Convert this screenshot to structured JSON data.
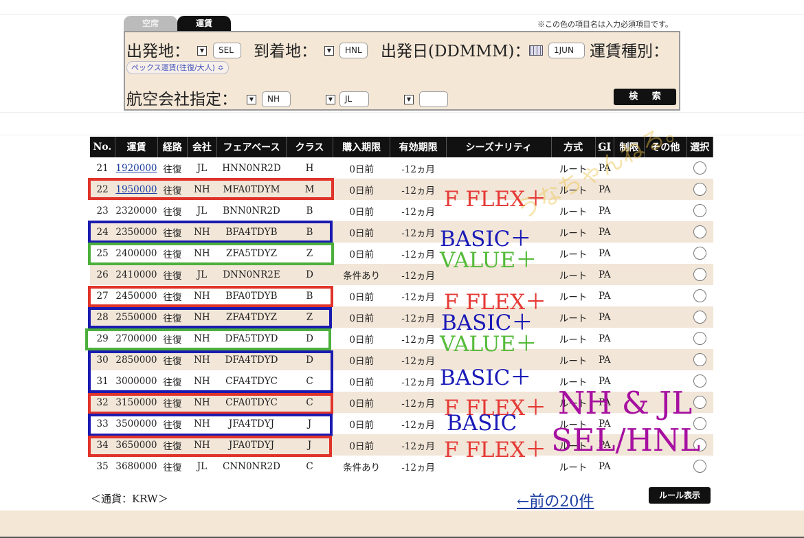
{
  "tabs": [
    {
      "label": "空席",
      "active": false
    },
    {
      "label": "運賃",
      "active": true
    }
  ],
  "required_note": "※この色の項目名は入力必須項目です。",
  "search": {
    "origin_label": "出発地：",
    "origin_value": "SEL",
    "dest_label": "到着地：",
    "dest_value": "HNL",
    "date_label": "出発日(DDMMM)：",
    "date_value": "1JUN",
    "fare_type_label": "運賃種別：",
    "fare_type_value": "ペックス運賃(往復/大人)",
    "airline_label": "航空会社指定：",
    "airline1": "NH",
    "airline2": "JL",
    "airline3": "",
    "search_button": "検 索"
  },
  "table": {
    "headers": [
      "No.",
      "運賃",
      "経路",
      "会社",
      "フェアベース",
      "クラス",
      "購入期限",
      "有効期限",
      "シーズナリティ",
      "方式",
      "GI",
      "制限",
      "その他",
      "選択"
    ],
    "rows": [
      {
        "no": "21",
        "fare": "1920000",
        "linked": true,
        "route": "往復",
        "carrier": "JL",
        "fare_basis": "HNN0NR2D",
        "class": "H",
        "purchase": "0日前",
        "validity": "-12ヵ月",
        "method": "ルート",
        "gi": "PA"
      },
      {
        "no": "22",
        "fare": "1950000",
        "linked": true,
        "route": "往復",
        "carrier": "NH",
        "fare_basis": "MFA0TDYM",
        "class": "M",
        "purchase": "0日前",
        "validity": "-12ヵ月",
        "method": "ルート",
        "gi": "PA"
      },
      {
        "no": "23",
        "fare": "2320000",
        "linked": false,
        "route": "往復",
        "carrier": "JL",
        "fare_basis": "BNN0NR2D",
        "class": "B",
        "purchase": "0日前",
        "validity": "-12ヵ月",
        "method": "ルート",
        "gi": "PA"
      },
      {
        "no": "24",
        "fare": "2350000",
        "linked": false,
        "route": "往復",
        "carrier": "NH",
        "fare_basis": "BFA4TDYB",
        "class": "B",
        "purchase": "0日前",
        "validity": "-12ヵ月",
        "method": "ルート",
        "gi": "PA"
      },
      {
        "no": "25",
        "fare": "2400000",
        "linked": false,
        "route": "往復",
        "carrier": "NH",
        "fare_basis": "ZFA5TDYZ",
        "class": "Z",
        "purchase": "0日前",
        "validity": "-12ヵ月",
        "method": "ルート",
        "gi": "PA"
      },
      {
        "no": "26",
        "fare": "2410000",
        "linked": false,
        "route": "往復",
        "carrier": "JL",
        "fare_basis": "DNN0NR2E",
        "class": "D",
        "purchase": "条件あり",
        "validity": "-12ヵ月",
        "method": "ルート",
        "gi": "PA"
      },
      {
        "no": "27",
        "fare": "2450000",
        "linked": false,
        "route": "往復",
        "carrier": "NH",
        "fare_basis": "BFA0TDYB",
        "class": "B",
        "purchase": "0日前",
        "validity": "-12ヵ月",
        "method": "ルート",
        "gi": "PA"
      },
      {
        "no": "28",
        "fare": "2550000",
        "linked": false,
        "route": "往復",
        "carrier": "NH",
        "fare_basis": "ZFA4TDYZ",
        "class": "Z",
        "purchase": "0日前",
        "validity": "-12ヵ月",
        "method": "ルート",
        "gi": "PA"
      },
      {
        "no": "29",
        "fare": "2700000",
        "linked": false,
        "route": "往復",
        "carrier": "NH",
        "fare_basis": "DFA5TDYD",
        "class": "D",
        "purchase": "0日前",
        "validity": "-12ヵ月",
        "method": "ルート",
        "gi": "PA"
      },
      {
        "no": "30",
        "fare": "2850000",
        "linked": false,
        "route": "往復",
        "carrier": "NH",
        "fare_basis": "DFA4TDYD",
        "class": "D",
        "purchase": "0日前",
        "validity": "-12ヵ月",
        "method": "ルート",
        "gi": "PA"
      },
      {
        "no": "31",
        "fare": "3000000",
        "linked": false,
        "route": "往復",
        "carrier": "NH",
        "fare_basis": "CFA4TDYC",
        "class": "C",
        "purchase": "0日前",
        "validity": "-12ヵ月",
        "method": "ルート",
        "gi": "PA"
      },
      {
        "no": "32",
        "fare": "3150000",
        "linked": false,
        "route": "往復",
        "carrier": "NH",
        "fare_basis": "CFA0TDYC",
        "class": "C",
        "purchase": "0日前",
        "validity": "-12ヵ月",
        "method": "ルート",
        "gi": "PA"
      },
      {
        "no": "33",
        "fare": "3500000",
        "linked": false,
        "route": "往復",
        "carrier": "NH",
        "fare_basis": "JFA4TDYJ",
        "class": "J",
        "purchase": "0日前",
        "validity": "-12ヵ月",
        "method": "ルート",
        "gi": "PA"
      },
      {
        "no": "34",
        "fare": "3650000",
        "linked": false,
        "route": "往復",
        "carrier": "NH",
        "fare_basis": "JFA0TDYJ",
        "class": "J",
        "purchase": "0日前",
        "validity": "-12ヵ月",
        "method": "ルート",
        "gi": "PA"
      },
      {
        "no": "35",
        "fare": "3680000",
        "linked": false,
        "route": "往復",
        "carrier": "JL",
        "fare_basis": "CNN0NR2D",
        "class": "C",
        "purchase": "条件あり",
        "validity": "-12ヵ月",
        "method": "ルート",
        "gi": "PA"
      }
    ]
  },
  "annotations": {
    "fflex": "F FLEX＋",
    "basic_plus": "BASIC＋",
    "value_plus": "VALUE＋",
    "basic": "BASIC",
    "carriers": "NH & JL",
    "route": "SEL/HNL",
    "watermark": "うなちゃんねる。",
    "colors": {
      "red": "#e53a36",
      "blue": "#1a1ab8",
      "green": "#55bb3a",
      "purple": "#a60fa0"
    }
  },
  "footer": {
    "currency": "＜通貨：KRW＞",
    "prev_link": "←前の20件",
    "rule_button": "ルール表示"
  }
}
